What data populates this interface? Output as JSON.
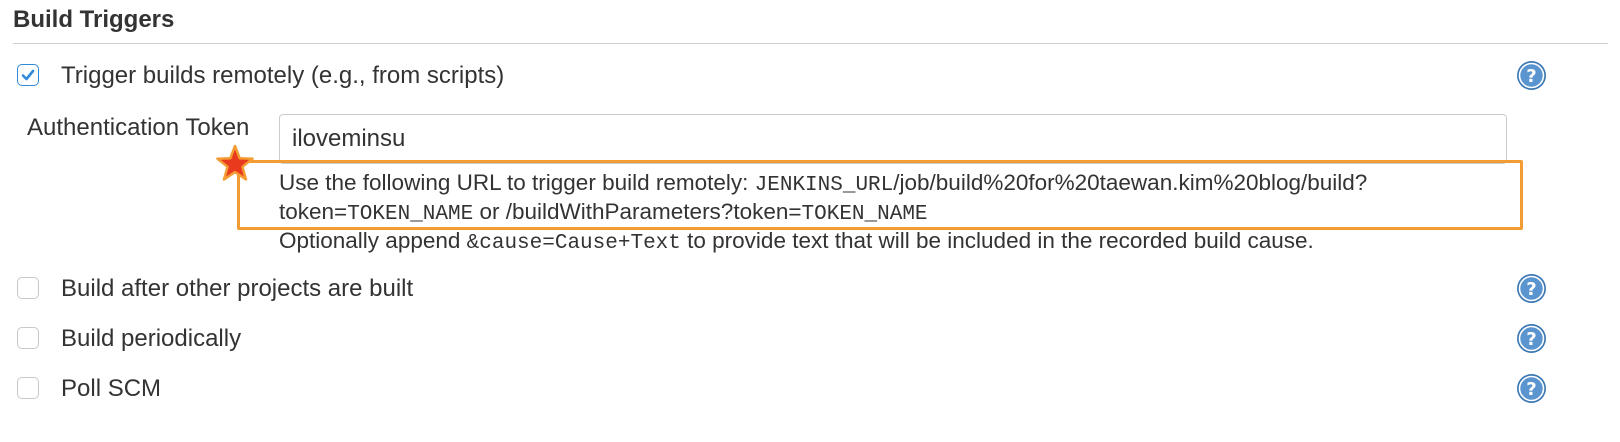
{
  "section": {
    "title": "Build Triggers"
  },
  "triggers": [
    {
      "label": "Trigger builds remotely (e.g., from scripts)",
      "checked": true
    },
    {
      "label": "Build after other projects are built",
      "checked": false
    },
    {
      "label": "Build periodically",
      "checked": false
    },
    {
      "label": "Poll SCM",
      "checked": false
    }
  ],
  "remote": {
    "token_label": "Authentication Token",
    "token_value": "iloveminsu",
    "help_line1_text": "Use the following URL to trigger build remotely: ",
    "help_line1_code": "JENKINS_URL",
    "help_line1_path": "/job/build%20for%20taewan.kim%20blog/build?",
    "help_line2_prefix": "token=",
    "help_line2_code1": "TOKEN_NAME",
    "help_line2_middle": " or /buildWithParameters?token=",
    "help_line2_code2": "TOKEN_NAME",
    "help_line3_prefix": "Optionally append ",
    "help_line3_code": "&cause=Cause+Text",
    "help_line3_suffix": " to provide text that will be included in the recorded build cause."
  },
  "icons": {
    "help": "question-mark-help-icon",
    "checkmark": "checkmark-icon",
    "star": "star-icon"
  },
  "colors": {
    "accent_blue": "#2f8ad8",
    "help_blue": "#3c78b4",
    "highlight_orange": "#f39c34",
    "star_red": "#ea3a1e"
  }
}
